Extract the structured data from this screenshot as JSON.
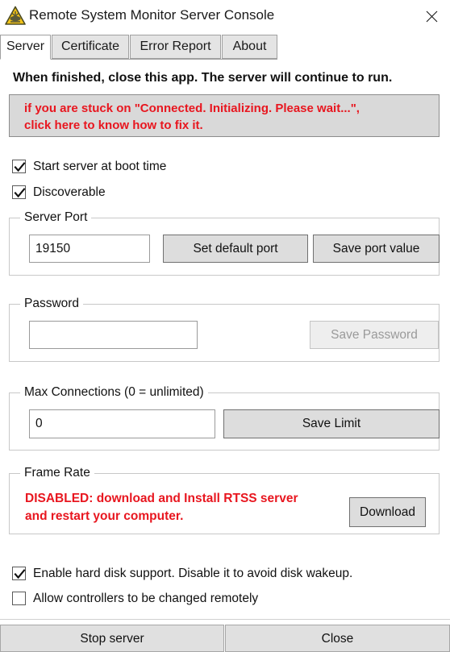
{
  "window": {
    "title": "Remote System Monitor Server Console",
    "icon": "warning-triangle-icon",
    "close_label": "✕"
  },
  "tabs": [
    {
      "label": "Server",
      "active": true
    },
    {
      "label": "Certificate",
      "active": false
    },
    {
      "label": "Error Report",
      "active": false
    },
    {
      "label": "About",
      "active": false
    }
  ],
  "server_tab": {
    "headline": "When finished, close this app. The server will continue to run.",
    "warning_banner": {
      "line1": "if you are stuck on \"Connected. Initializing. Please wait...\",",
      "line2": "click here to know how to fix it."
    },
    "checkboxes": [
      {
        "label": "Start server at boot time",
        "checked": true
      },
      {
        "label": "Discoverable",
        "checked": true
      }
    ],
    "server_port": {
      "group_title": "Server Port",
      "value": "19150",
      "placeholder": "",
      "set_default_label": "Set default port",
      "save_label": "Save port value"
    },
    "password": {
      "group_title": "Password",
      "value": "",
      "placeholder": "",
      "save_label": "Save Password",
      "save_disabled": true
    },
    "max_connections": {
      "group_title": "Max Connections (0 = unlimited)",
      "value": "0",
      "placeholder": "",
      "save_label": "Save Limit"
    },
    "frame_rate": {
      "group_title": "Frame Rate",
      "message_line1": "DISABLED: download and Install RTSS server",
      "message_line2": "and restart your computer.",
      "download_label": "Download"
    },
    "bottom_checkboxes": [
      {
        "label": "Enable hard disk support. Disable it to avoid disk wakeup.",
        "checked": true
      },
      {
        "label": "Allow controllers to be changed remotely",
        "checked": false
      }
    ]
  },
  "footer": {
    "stop_label": "Stop server",
    "close_label": "Close"
  },
  "colors": {
    "alert_red": "#e8161f",
    "banner_bg": "#d9d9d9",
    "button_face": "#dddddd",
    "tab_inactive": "#e4e4e4",
    "icon_yellow": "#f2c318"
  }
}
